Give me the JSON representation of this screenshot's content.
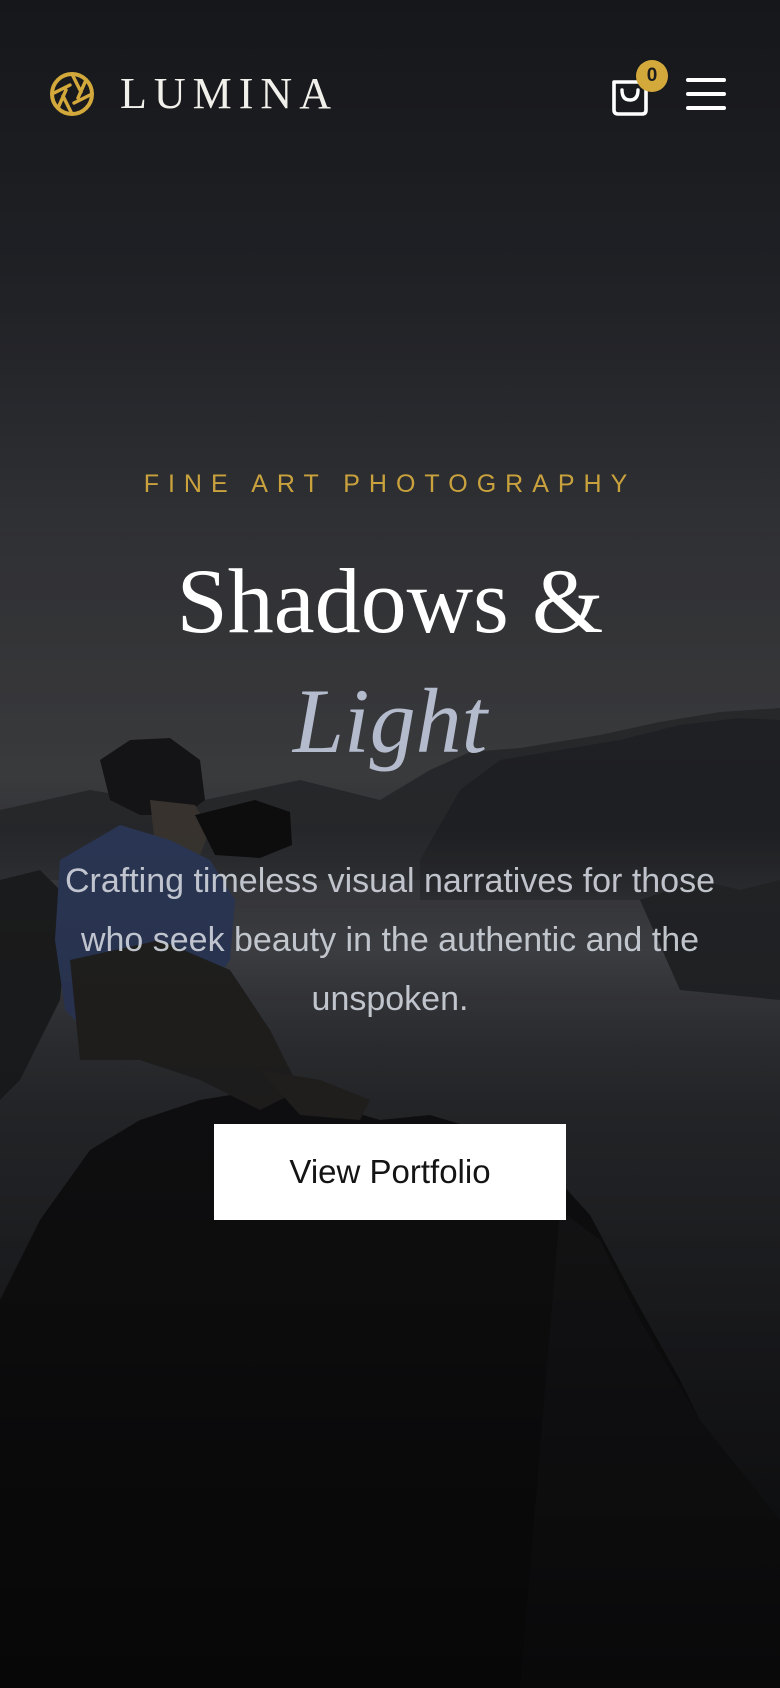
{
  "header": {
    "brand": "LUMINA",
    "logo_icon": "aperture-icon",
    "cart_icon": "shopping-bag-icon",
    "cart_count": "0",
    "menu_icon": "hamburger-menu-icon"
  },
  "hero": {
    "eyebrow": "FINE ART PHOTOGRAPHY",
    "title_line1": "Shadows &",
    "title_line2": "Light",
    "subtitle": "Crafting timeless visual narratives for those who seek beauty in the authentic and the unspoken.",
    "cta_label": "View Portfolio",
    "background": "photographer-on-mountain-peak-above-clouds"
  },
  "colors": {
    "accent_gold": "#d4a93c",
    "eyebrow_gold": "#c9a23d",
    "title_white": "#ffffff",
    "title_italic": "#b4bbcc",
    "background_dark": "#1b1c1f"
  }
}
